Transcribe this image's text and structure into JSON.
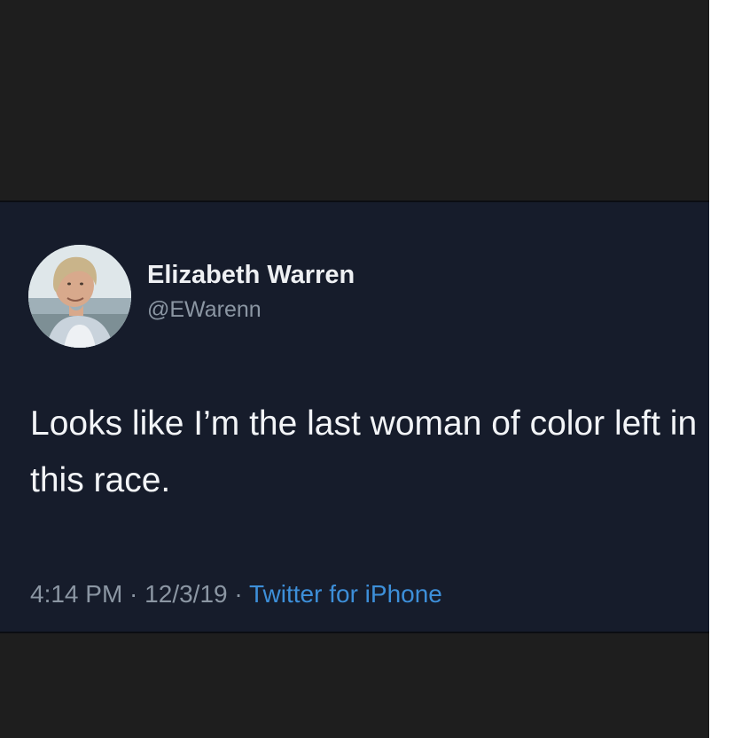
{
  "tweet": {
    "display_name": "Elizabeth Warren",
    "handle": "@EWarenn",
    "text": "Looks like I’m the last woman of color left in this race.",
    "time": "4:14 PM",
    "separator": " · ",
    "date": "12/3/19",
    "source": "Twitter for iPhone",
    "avatar_icon": "profile-photo"
  },
  "colors": {
    "card_background": "#161c2b",
    "outer_background": "#1e1e1e",
    "source_link": "#3d8fd9",
    "muted_text": "#8b96a3"
  }
}
